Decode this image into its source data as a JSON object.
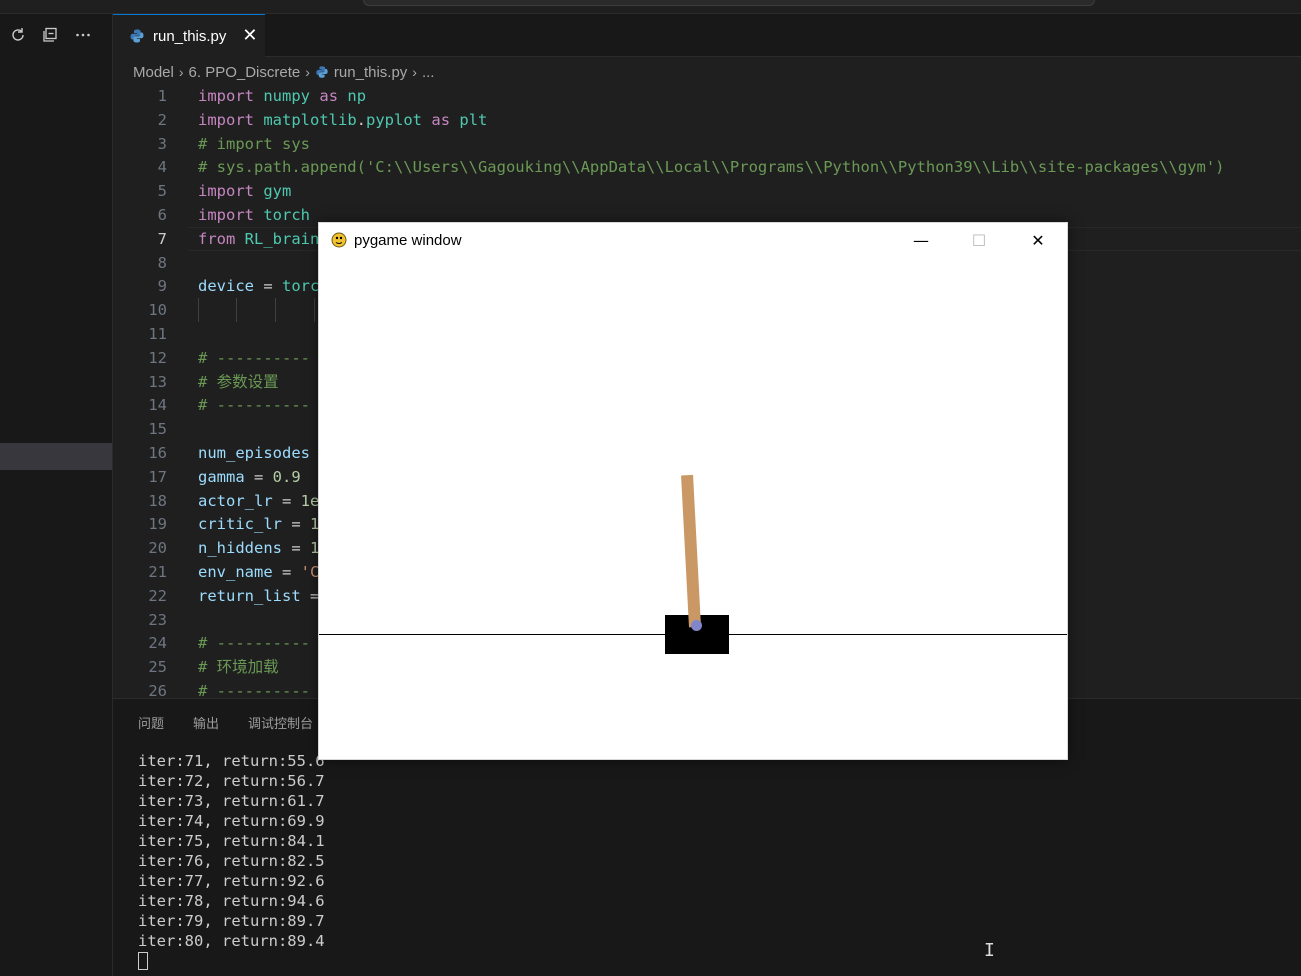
{
  "editor": {
    "tab": {
      "filename": "run_this.py",
      "close": "✕"
    },
    "breadcrumb": [
      "Model",
      "6. PPO_Discrete",
      "run_this.py",
      "..."
    ],
    "lines": [
      {
        "n": "1",
        "tokens": [
          [
            "kw",
            "import"
          ],
          [
            "plain",
            " "
          ],
          [
            "mod",
            "numpy"
          ],
          [
            "plain",
            " "
          ],
          [
            "kw",
            "as"
          ],
          [
            "plain",
            " "
          ],
          [
            "mod",
            "np"
          ]
        ]
      },
      {
        "n": "2",
        "tokens": [
          [
            "kw",
            "import"
          ],
          [
            "plain",
            " "
          ],
          [
            "mod",
            "matplotlib"
          ],
          [
            "plain",
            "."
          ],
          [
            "mod",
            "pyplot"
          ],
          [
            "plain",
            " "
          ],
          [
            "kw",
            "as"
          ],
          [
            "plain",
            " "
          ],
          [
            "mod",
            "plt"
          ]
        ]
      },
      {
        "n": "3",
        "tokens": [
          [
            "cm",
            "# import sys"
          ]
        ]
      },
      {
        "n": "4",
        "tokens": [
          [
            "cm",
            "# sys.path.append('C:\\\\Users\\\\Gagouking\\\\AppData\\\\Local\\\\Programs\\\\Python\\\\Python39\\\\Lib\\\\site-packages\\\\gym')"
          ]
        ]
      },
      {
        "n": "5",
        "tokens": [
          [
            "kw",
            "import"
          ],
          [
            "plain",
            " "
          ],
          [
            "mod",
            "gym"
          ]
        ]
      },
      {
        "n": "6",
        "tokens": [
          [
            "kw",
            "import"
          ],
          [
            "plain",
            " "
          ],
          [
            "mod",
            "torch"
          ]
        ]
      },
      {
        "n": "7",
        "tokens": [
          [
            "kw",
            "from"
          ],
          [
            "plain",
            " "
          ],
          [
            "mod",
            "RL_brain"
          ]
        ]
      },
      {
        "n": "8",
        "tokens": []
      },
      {
        "n": "9",
        "tokens": [
          [
            "var",
            "device"
          ],
          [
            "plain",
            " = "
          ],
          [
            "mod",
            "torc"
          ]
        ]
      },
      {
        "n": "10",
        "tokens": []
      },
      {
        "n": "11",
        "tokens": []
      },
      {
        "n": "12",
        "tokens": [
          [
            "cm",
            "# ----------"
          ]
        ]
      },
      {
        "n": "13",
        "tokens": [
          [
            "cm",
            "# 参数设置"
          ]
        ]
      },
      {
        "n": "14",
        "tokens": [
          [
            "cm",
            "# ----------"
          ]
        ]
      },
      {
        "n": "15",
        "tokens": []
      },
      {
        "n": "16",
        "tokens": [
          [
            "var",
            "num_episodes"
          ]
        ]
      },
      {
        "n": "17",
        "tokens": [
          [
            "var",
            "gamma"
          ],
          [
            "plain",
            " = "
          ],
          [
            "num",
            "0.9"
          ]
        ]
      },
      {
        "n": "18",
        "tokens": [
          [
            "var",
            "actor_lr"
          ],
          [
            "plain",
            " = "
          ],
          [
            "num",
            "1e"
          ]
        ]
      },
      {
        "n": "19",
        "tokens": [
          [
            "var",
            "critic_lr"
          ],
          [
            "plain",
            " = "
          ],
          [
            "num",
            "1"
          ]
        ]
      },
      {
        "n": "20",
        "tokens": [
          [
            "var",
            "n_hiddens"
          ],
          [
            "plain",
            " = "
          ],
          [
            "num",
            "1"
          ]
        ]
      },
      {
        "n": "21",
        "tokens": [
          [
            "var",
            "env_name"
          ],
          [
            "plain",
            " = "
          ],
          [
            "str",
            "'C"
          ]
        ]
      },
      {
        "n": "22",
        "tokens": [
          [
            "var",
            "return_list"
          ],
          [
            "plain",
            " ="
          ]
        ]
      },
      {
        "n": "23",
        "tokens": []
      },
      {
        "n": "24",
        "tokens": [
          [
            "cm",
            "# ----------"
          ]
        ]
      },
      {
        "n": "25",
        "tokens": [
          [
            "cm",
            "# 环境加载"
          ]
        ]
      },
      {
        "n": "26",
        "tokens": [
          [
            "cm",
            "# ----------"
          ]
        ]
      }
    ],
    "active_line": "7"
  },
  "panel": {
    "tabs": [
      "问题",
      "输出",
      "调试控制台"
    ],
    "terminal_lines": [
      "iter:71, return:55.6",
      "iter:72, return:56.7",
      "iter:73, return:61.7",
      "iter:74, return:69.9",
      "iter:75, return:84.1",
      "iter:76, return:82.5",
      "iter:77, return:92.6",
      "iter:78, return:94.6",
      "iter:79, return:89.7",
      "iter:80, return:89.4"
    ]
  },
  "pygame": {
    "title": "pygame window",
    "buttons": {
      "minimize": "—",
      "maximize": "☐",
      "close": "✕"
    },
    "colors": {
      "pole": "#ca9865",
      "cart": "#000000",
      "axle": "#8185ca",
      "background": "#ffffff"
    }
  },
  "sidebar": {
    "icons": [
      "refresh-icon",
      "collapse-all-icon",
      "more-icon"
    ]
  }
}
